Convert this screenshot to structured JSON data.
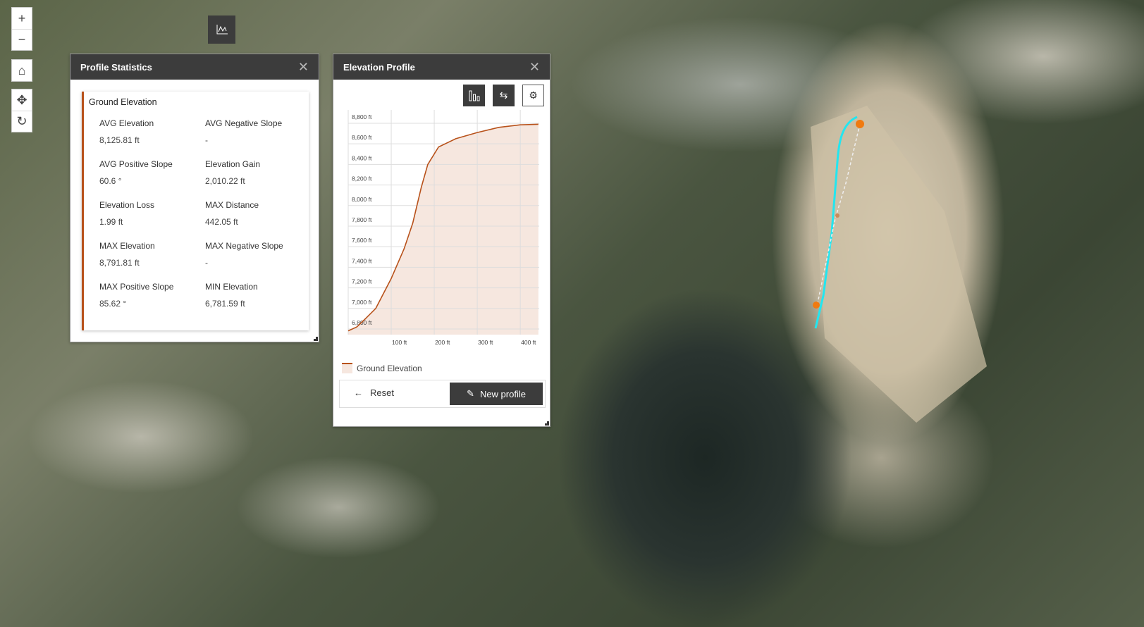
{
  "map_controls": {
    "zoom_in": "+",
    "zoom_out": "−",
    "home": "⌂",
    "pan": "✥",
    "rotate": "↻"
  },
  "stats_panel": {
    "title": "Profile Statistics",
    "close": "✕",
    "card_title": "Ground Elevation",
    "stats": [
      {
        "label": "AVG Elevation",
        "value": "8,125.81 ft"
      },
      {
        "label": "AVG Negative Slope",
        "value": "-"
      },
      {
        "label": "AVG Positive Slope",
        "value": "60.6 °"
      },
      {
        "label": "Elevation Gain",
        "value": "2,010.22 ft"
      },
      {
        "label": "Elevation Loss",
        "value": "1.99 ft"
      },
      {
        "label": "MAX Distance",
        "value": "442.05 ft"
      },
      {
        "label": "MAX Elevation",
        "value": "8,791.81 ft"
      },
      {
        "label": "MAX Negative Slope",
        "value": "-"
      },
      {
        "label": "MAX Positive Slope",
        "value": "85.62 °"
      },
      {
        "label": "MIN Elevation",
        "value": "6,781.59 ft"
      }
    ]
  },
  "profile_panel": {
    "title": "Elevation Profile",
    "close": "✕",
    "legend": "Ground Elevation",
    "reset": "Reset",
    "new_profile": "New profile"
  },
  "colors": {
    "line": "#b8521b",
    "fill": "#f6e7df",
    "route": "#22e6f0",
    "marker": "#f07a10"
  },
  "chart_data": {
    "type": "area",
    "title": "",
    "xlabel": "",
    "ylabel": "",
    "xlim": [
      0,
      444
    ],
    "ylim": [
      6745,
      8930
    ],
    "yticks": [
      6800,
      7000,
      7200,
      7400,
      7600,
      7800,
      8000,
      8200,
      8400,
      8600,
      8800
    ],
    "ytick_labels": [
      "6,800 ft",
      "7,000 ft",
      "7,200 ft",
      "7,400 ft",
      "7,600 ft",
      "7,800 ft",
      "8,000 ft",
      "8,200 ft",
      "8,400 ft",
      "8,600 ft",
      "8,800 ft"
    ],
    "xticks": [
      100,
      200,
      300,
      400
    ],
    "xtick_labels": [
      "100 ft",
      "200 ft",
      "300 ft",
      "400 ft"
    ],
    "series": [
      {
        "name": "Ground Elevation",
        "x": [
          0,
          20,
          40,
          64,
          100,
          130,
          150,
          170,
          185,
          210,
          250,
          300,
          350,
          400,
          442
        ],
        "y": [
          6782,
          6820,
          6900,
          7000,
          7290,
          7580,
          7830,
          8180,
          8400,
          8570,
          8650,
          8710,
          8760,
          8785,
          8790
        ]
      }
    ],
    "grid": true,
    "legend": "bottom-left"
  }
}
